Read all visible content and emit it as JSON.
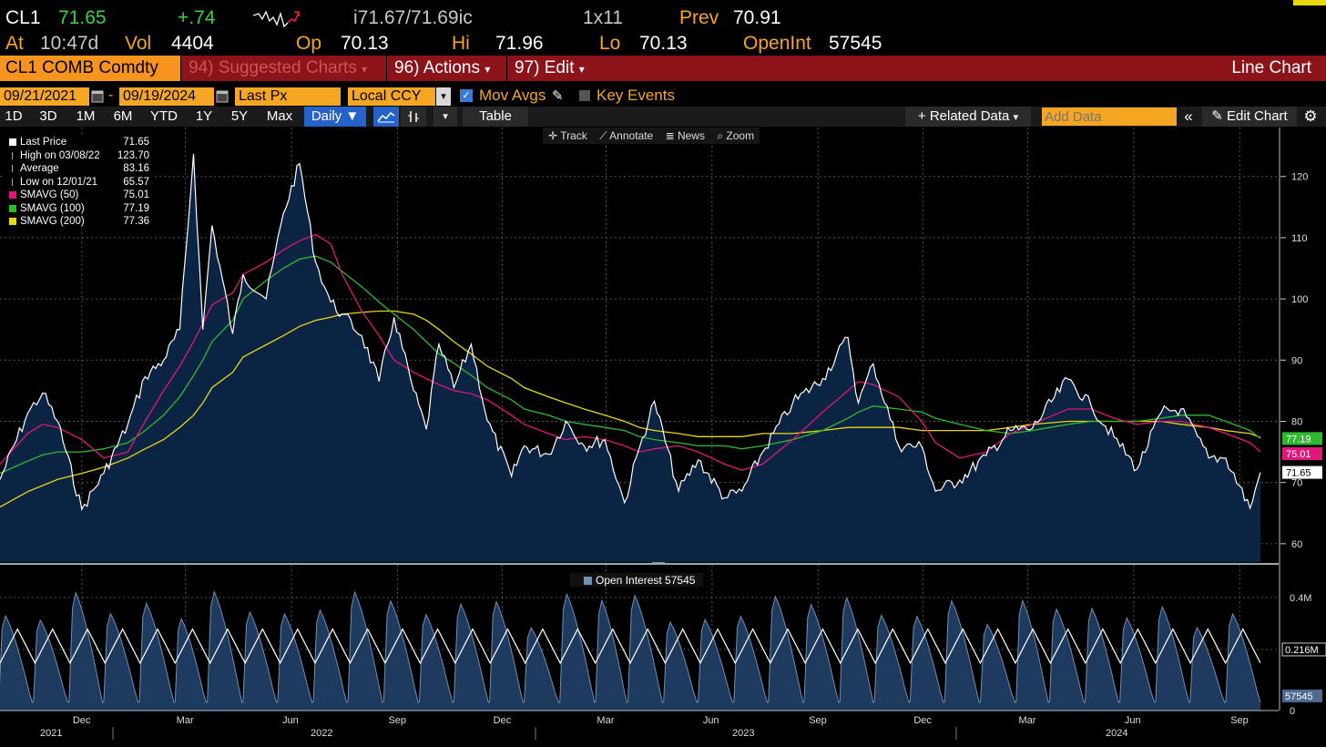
{
  "header": {
    "ticker": "CL1",
    "last": "71.65",
    "change": "+.74",
    "bid_ask": "i71.67/71.69ic",
    "size": "1x11",
    "prev_label": "Prev",
    "prev": "70.91",
    "at_label": "At",
    "time": "10:47d",
    "vol_label": "Vol",
    "vol": "4404",
    "op_label": "Op",
    "open": "70.13",
    "hi_label": "Hi",
    "high": "71.96",
    "lo_label": "Lo",
    "low": "70.13",
    "oi_label": "OpenInt",
    "open_interest": "57545"
  },
  "menubar": {
    "security": "CL1 COMB Comdty",
    "suggested": "94) Suggested Charts",
    "actions": "96) Actions",
    "edit": "97) Edit",
    "title": "Line Chart"
  },
  "controls": {
    "start_date": "09/21/2021",
    "end_date": "09/19/2024",
    "field": "Last Px",
    "currency": "Local CCY",
    "mov_avgs": "Mov Avgs",
    "key_events": "Key Events"
  },
  "toolbar": {
    "periods": [
      "1D",
      "3D",
      "1M",
      "6M",
      "YTD",
      "1Y",
      "5Y",
      "Max"
    ],
    "frequency": "Daily",
    "table": "Table",
    "related": "Related Data",
    "add_data_placeholder": "Add Data",
    "edit_chart": "Edit Chart"
  },
  "chart_tools": {
    "track": "Track",
    "annotate": "Annotate",
    "news": "News",
    "zoom": "Zoom"
  },
  "colors": {
    "price_line": "#ffffff",
    "area_fill": "#0c2444",
    "sma50": "#e0177a",
    "sma100": "#2fb92f",
    "sma200": "#e8d60f",
    "oi_fill": "#1e3a5f",
    "accent_orange": "#f5a623",
    "menu_red": "#8b1319"
  },
  "legend": [
    {
      "label": "Last Price",
      "value": "71.65",
      "color": "#ffffff",
      "icon": "square"
    },
    {
      "label": "High on 03/08/22",
      "value": "123.70",
      "color": "#aaaaaa",
      "icon": "high-marker"
    },
    {
      "label": "Average",
      "value": "83.16",
      "color": "#aaaaaa",
      "icon": "average-marker"
    },
    {
      "label": "Low on 12/01/21",
      "value": "65.57",
      "color": "#aaaaaa",
      "icon": "low-marker"
    },
    {
      "label": "SMAVG (50)",
      "value": "75.01",
      "color": "#e0177a",
      "icon": "square"
    },
    {
      "label": "SMAVG (100)",
      "value": "77.19",
      "color": "#2fb92f",
      "icon": "square"
    },
    {
      "label": "SMAVG (200)",
      "value": "77.36",
      "color": "#e8d60f",
      "icon": "square"
    }
  ],
  "chart_data": [
    {
      "type": "line",
      "x": [
        "2021-09-21",
        "2021-10-15",
        "2021-10-28",
        "2021-11-10",
        "2021-12-01",
        "2021-12-20",
        "2022-01-10",
        "2022-01-25",
        "2022-02-10",
        "2022-02-24",
        "2022-03-08",
        "2022-03-16",
        "2022-03-24",
        "2022-04-11",
        "2022-04-20",
        "2022-05-10",
        "2022-05-25",
        "2022-06-08",
        "2022-06-22",
        "2022-07-05",
        "2022-07-15",
        "2022-08-01",
        "2022-08-16",
        "2022-08-29",
        "2022-09-15",
        "2022-09-26",
        "2022-10-07",
        "2022-10-20",
        "2022-11-04",
        "2022-11-18",
        "2022-12-09",
        "2022-12-20",
        "2023-01-10",
        "2023-01-25",
        "2023-02-10",
        "2023-02-28",
        "2023-03-17",
        "2023-03-30",
        "2023-04-12",
        "2023-05-03",
        "2023-05-20",
        "2023-06-12",
        "2023-06-27",
        "2023-07-15",
        "2023-08-10",
        "2023-09-05",
        "2023-09-27",
        "2023-10-06",
        "2023-10-19",
        "2023-11-10",
        "2023-11-30",
        "2023-12-12",
        "2024-01-02",
        "2024-01-25",
        "2024-02-15",
        "2024-03-05",
        "2024-04-05",
        "2024-04-25",
        "2024-05-15",
        "2024-06-04",
        "2024-06-25",
        "2024-07-12",
        "2024-08-05",
        "2024-08-20",
        "2024-09-10",
        "2024-09-19"
      ],
      "series": [
        {
          "name": "Last Price",
          "values": [
            70.5,
            81.3,
            84.6,
            80.0,
            65.6,
            71.5,
            79.5,
            87.3,
            90.0,
            95.0,
            123.7,
            95.0,
            112.0,
            94.3,
            104.0,
            100.0,
            114.0,
            122.1,
            106.0,
            99.5,
            97.5,
            94.0,
            86.5,
            97.0,
            85.0,
            78.7,
            92.6,
            85.5,
            92.6,
            80.1,
            71.0,
            76.0,
            74.6,
            80.0,
            76.0,
            77.0,
            66.7,
            75.7,
            83.3,
            68.6,
            73.7,
            67.5,
            68.6,
            75.0,
            83.0,
            87.0,
            93.7,
            83.0,
            89.4,
            76.0,
            75.9,
            68.6,
            70.4,
            74.4,
            78.5,
            78.8,
            86.9,
            82.6,
            77.4,
            72.2,
            81.5,
            82.0,
            74.0,
            74.0,
            65.8,
            71.65
          ]
        },
        {
          "name": "SMAVG (50)",
          "values": [
            73.0,
            78.0,
            79.5,
            79.0,
            77.0,
            74.0,
            75.0,
            80.0,
            85.0,
            89.0,
            93.0,
            96.0,
            99.0,
            101.0,
            104.0,
            106.0,
            108.0,
            109.5,
            110.5,
            109.0,
            104.0,
            98.0,
            94.0,
            90.0,
            88.0,
            87.0,
            86.0,
            85.0,
            84.5,
            83.5,
            81.0,
            79.5,
            78.0,
            77.0,
            77.5,
            77.0,
            76.0,
            75.0,
            75.5,
            76.0,
            75.0,
            73.0,
            72.0,
            73.0,
            77.0,
            81.5,
            85.0,
            86.5,
            86.0,
            84.0,
            80.0,
            76.5,
            74.0,
            75.0,
            78.0,
            79.5,
            82.0,
            82.0,
            80.5,
            79.5,
            80.0,
            80.0,
            79.0,
            78.0,
            76.5,
            75.01
          ]
        },
        {
          "name": "SMAVG (100)",
          "values": [
            71.5,
            73.5,
            74.5,
            75.0,
            75.0,
            75.5,
            76.5,
            78.5,
            81.0,
            84.0,
            87.5,
            90.0,
            93.0,
            96.5,
            100.0,
            103.0,
            105.0,
            106.5,
            107.0,
            106.0,
            104.5,
            102.0,
            99.5,
            97.5,
            95.0,
            93.0,
            91.0,
            89.5,
            87.5,
            85.5,
            83.5,
            82.0,
            81.0,
            80.0,
            79.5,
            79.0,
            78.5,
            77.5,
            77.0,
            76.5,
            76.0,
            76.0,
            75.5,
            76.0,
            77.0,
            78.5,
            80.5,
            81.5,
            82.5,
            82.0,
            81.5,
            80.5,
            79.5,
            78.5,
            78.0,
            78.5,
            79.5,
            80.0,
            80.0,
            80.0,
            80.5,
            81.0,
            81.0,
            80.0,
            78.5,
            77.19
          ]
        },
        {
          "name": "SMAVG (200)",
          "values": [
            66.0,
            68.5,
            69.5,
            70.5,
            71.5,
            72.5,
            74.0,
            75.5,
            77.0,
            79.0,
            81.0,
            83.0,
            85.5,
            88.0,
            90.5,
            92.5,
            94.0,
            95.5,
            96.5,
            97.0,
            97.5,
            97.8,
            98.0,
            98.0,
            97.5,
            96.5,
            95.0,
            93.0,
            91.0,
            89.0,
            87.0,
            85.5,
            84.0,
            83.0,
            82.0,
            81.0,
            80.0,
            79.0,
            78.5,
            78.0,
            77.5,
            77.5,
            77.5,
            78.0,
            78.0,
            78.5,
            79.0,
            79.0,
            79.0,
            79.0,
            78.5,
            78.5,
            78.5,
            78.5,
            79.0,
            79.5,
            80.0,
            80.0,
            80.0,
            80.0,
            80.0,
            79.5,
            79.0,
            78.5,
            78.0,
            77.36
          ]
        }
      ],
      "ylim": [
        57,
        128
      ],
      "yticks": [
        60,
        70,
        80,
        90,
        100,
        110,
        120
      ],
      "ytick_labels": [
        "60",
        "70",
        "80",
        "90",
        "100",
        "110",
        "120"
      ],
      "axis_tags": [
        "77.19",
        "75.01",
        "71.65"
      ],
      "grid": true,
      "legend_position": "top-left"
    },
    {
      "type": "area",
      "name": "Open Interest",
      "title": "Open Interest 57545",
      "pattern": "monthly contract roll sawtooth",
      "roll_peak_approx": 400000,
      "avg_line_approx": 216000,
      "last_value": 57545,
      "ylim": [
        0,
        480000
      ],
      "yticks": [
        0,
        216000,
        400000
      ],
      "ytick_labels": [
        "0",
        "0.216M",
        "0.4M"
      ],
      "axis_tags": [
        "0.216M",
        "57545"
      ]
    }
  ],
  "xaxis": {
    "months": [
      "Dec",
      "Mar",
      "Jun",
      "Sep",
      "Dec",
      "Mar",
      "Jun",
      "Sep",
      "Dec",
      "Mar",
      "Jun",
      "Sep"
    ],
    "years": [
      "2021",
      "2022",
      "2023",
      "2024"
    ]
  }
}
